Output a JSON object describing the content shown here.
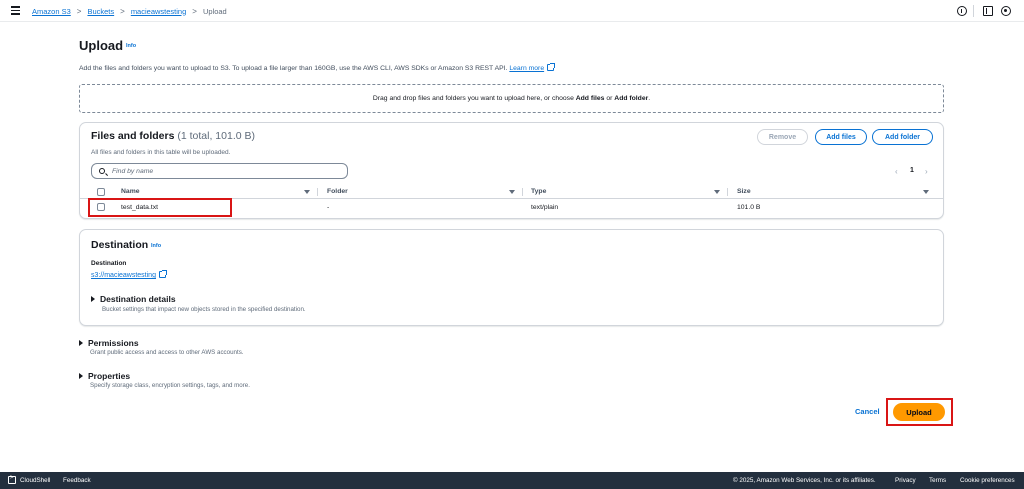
{
  "breadcrumb": {
    "items": [
      "Amazon S3",
      "Buckets",
      "macieawstesting"
    ],
    "current": "Upload",
    "separator": ">"
  },
  "page": {
    "title": "Upload",
    "info": "Info",
    "description": "Add the files and folders you want to upload to S3. To upload a file larger than 160GB, use the AWS CLI, AWS SDKs or Amazon S3 REST API.",
    "learn_more": "Learn more"
  },
  "dropzone": {
    "text_before": "Drag and drop files and folders you want to upload here, or choose",
    "add_files": "Add files",
    "or": "or",
    "add_folder": "Add folder",
    "end": "."
  },
  "files": {
    "title": "Files and folders",
    "count": "(1 total, 101.0 B)",
    "subtitle": "All files and folders in this table will be uploaded.",
    "remove_label": "Remove",
    "add_files_label": "Add files",
    "add_folder_label": "Add folder",
    "search_placeholder": "Find by name",
    "page": "1",
    "prev": "‹",
    "next": "›",
    "columns": [
      "Name",
      "Folder",
      "Type",
      "Size"
    ],
    "rows": [
      {
        "name": "test_data.txt",
        "folder": "-",
        "type": "text/plain",
        "size": "101.0 B"
      }
    ]
  },
  "destination": {
    "title": "Destination",
    "info": "Info",
    "label": "Destination",
    "link": "s3://macieawstesting",
    "details_title": "Destination details",
    "details_sub": "Bucket settings that impact new objects stored in the specified destination."
  },
  "permissions": {
    "title": "Permissions",
    "sub": "Grant public access and access to other AWS accounts."
  },
  "properties": {
    "title": "Properties",
    "sub": "Specify storage class, encryption settings, tags, and more."
  },
  "actions": {
    "cancel": "Cancel",
    "upload": "Upload"
  },
  "footer": {
    "cloudshell": "CloudShell",
    "feedback": "Feedback",
    "copyright": "© 2025, Amazon Web Services, Inc. or its affiliates.",
    "privacy": "Privacy",
    "terms": "Terms",
    "cookies": "Cookie preferences"
  },
  "colors": {
    "link": "#0972d3",
    "primary_button": "#ff9900",
    "footer_bg": "#232f3e",
    "highlight": "#d91515"
  }
}
